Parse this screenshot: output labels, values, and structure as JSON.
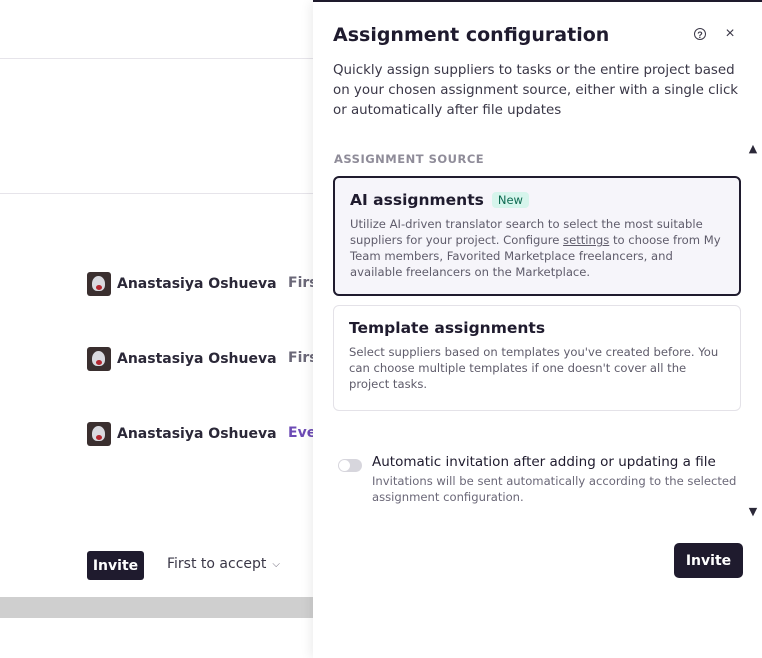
{
  "background": {
    "assignees": [
      {
        "name": "Anastasiya Oshueva",
        "mode": "Firs"
      },
      {
        "name": "Anastasiya Oshueva",
        "mode": "Firs"
      },
      {
        "name": "Anastasiya Oshueva",
        "mode": "Eve"
      }
    ],
    "invite_label": "Invite",
    "mode_select_label": "First to accept"
  },
  "panel": {
    "title": "Assignment configuration",
    "help_icon_text": "?",
    "close_icon_text": "×",
    "description": "Quickly assign suppliers to tasks or the entire project based on your chosen assignment source, either with a single click or automatically after file updates",
    "section_label": "ASSIGNMENT SOURCE",
    "ai_card": {
      "title": "AI assignments",
      "badge": "New",
      "desc_before": "Utilize AI-driven translator search to select the most suitable suppliers for your project. Configure ",
      "link": "settings",
      "desc_after": " to choose from My Team members, Favorited Marketplace freelancers, and available freelancers on the Marketplace."
    },
    "template_card": {
      "title": "Template assignments",
      "desc": "Select suppliers based on templates you've created before. You can choose multiple templates if one doesn't cover all the project tasks."
    },
    "auto_invite": {
      "title": "Automatic invitation after adding or updating a file",
      "desc": "Invitations will be sent automatically according to the selected assignment configuration.",
      "enabled": false
    },
    "invite_label": "Invite",
    "scroll_up_glyph": "▲",
    "scroll_down_glyph": "▼"
  },
  "colors": {
    "primary": "#1f1b2e",
    "badge_bg": "#d6f5ec",
    "badge_text": "#0f6b52",
    "purple_text": "#6d4bb5"
  }
}
